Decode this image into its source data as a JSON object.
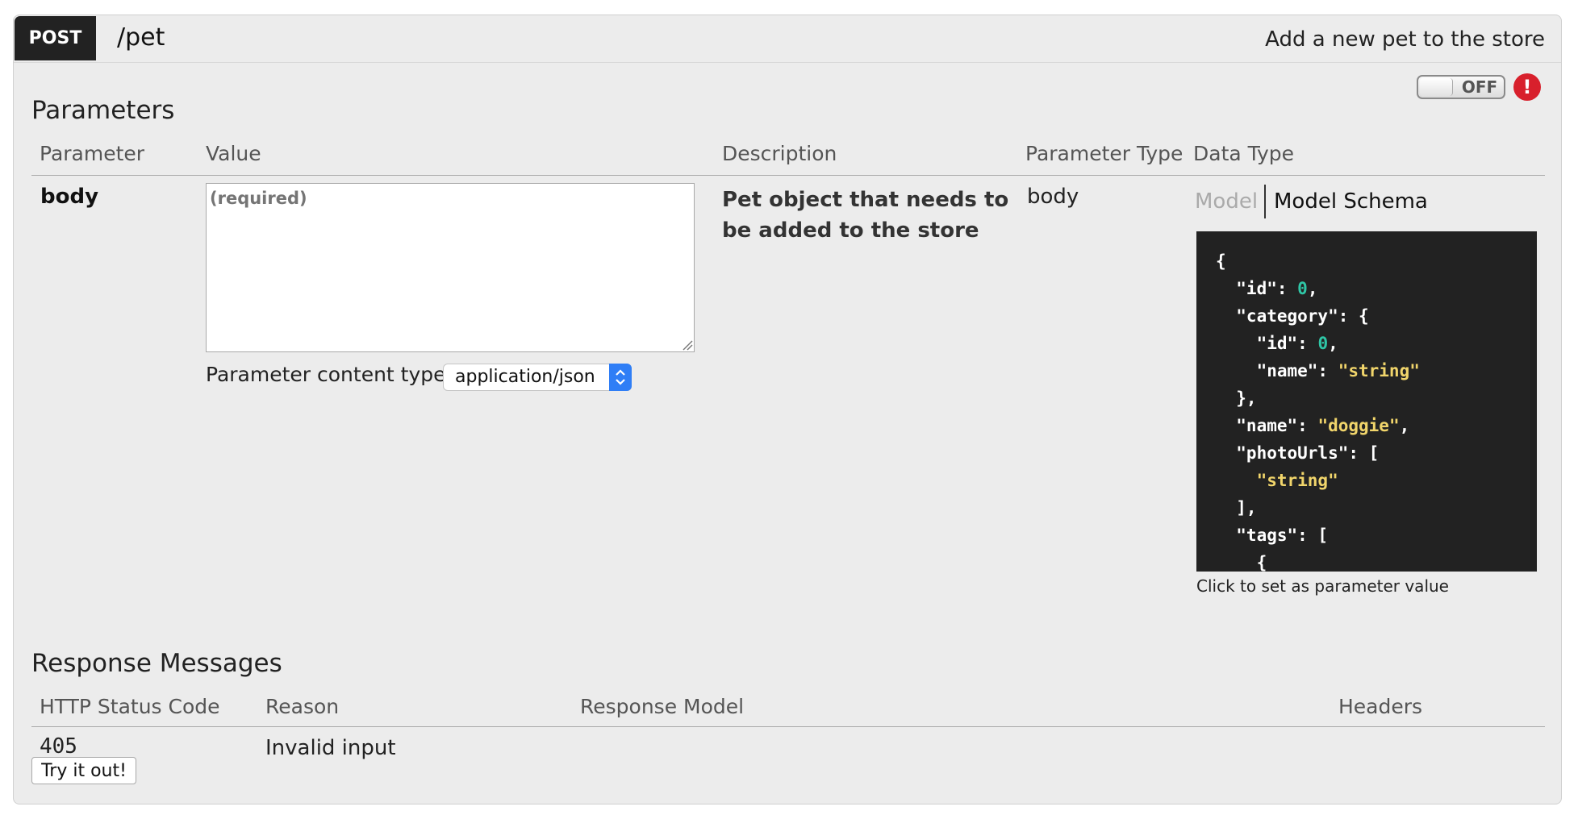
{
  "operation": {
    "method": "POST",
    "path": "/pet",
    "summary": "Add a new pet to the store"
  },
  "toggle": {
    "label": "OFF",
    "state": "off"
  },
  "parameters": {
    "title": "Parameters",
    "columns": [
      "Parameter",
      "Value",
      "Description",
      "Parameter Type",
      "Data Type"
    ],
    "rows": [
      {
        "name": "body",
        "placeholder": "(required)",
        "content_type_label": "Parameter content type:",
        "content_type_selected": "application/json",
        "description": "Pet object that needs to be added to the store",
        "param_type": "body",
        "data_type_tabs": [
          "Model",
          "Model Schema"
        ],
        "active_tab": "Model Schema",
        "schema_lines": [
          "{",
          "  \"id\": 0,",
          "  \"category\": {",
          "    \"id\": 0,",
          "    \"name\": \"string\"",
          "  },",
          "  \"name\": \"doggie\",",
          "  \"photoUrls\": [",
          "    \"string\"",
          "  ],",
          "  \"tags\": [",
          "    {"
        ],
        "schema_hint": "Click to set as parameter value"
      }
    ]
  },
  "responses": {
    "title": "Response Messages",
    "columns": [
      "HTTP Status Code",
      "Reason",
      "Response Model",
      "Headers"
    ],
    "rows": [
      {
        "code": "405",
        "reason": "Invalid input"
      }
    ]
  },
  "try_button_label": "Try it out!",
  "colors": {
    "method_bg": "#222222",
    "alert": "#d8202c",
    "select_accent": "#2f7ef6",
    "code_bg": "#222222",
    "code_number": "#2fc6a6",
    "code_string": "#f1d56b"
  }
}
